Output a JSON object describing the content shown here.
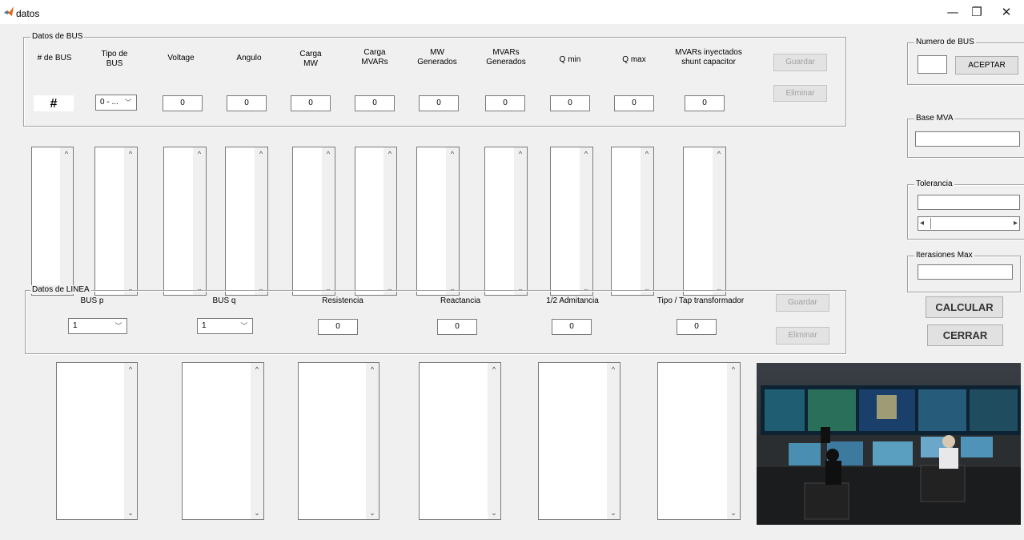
{
  "window": {
    "title": "datos",
    "minimize": "—",
    "restore": "❐",
    "close": "✕"
  },
  "bus_group": {
    "label": "Datos de BUS",
    "headers": [
      "# de BUS",
      "Tipo de\nBUS",
      "Voltage",
      "Angulo",
      "Carga\nMW",
      "Carga\nMVARs",
      "MW\nGenerados",
      "MVARs\nGenerados",
      "Q min",
      "Q  max",
      "MVARs inyectados\nshunt capacitor"
    ],
    "bus_number": "#",
    "tipo_value": "0 - ...",
    "values": [
      "0",
      "0",
      "0",
      "0",
      "0",
      "0",
      "0",
      "0",
      "0"
    ],
    "save_label": "Guardar",
    "delete_label": "Eliminar"
  },
  "line_group": {
    "label": "Datos de LINEA",
    "headers": [
      "BUS p",
      "BUS q",
      "Resistencia",
      "Reactancia",
      "1/2  Admitancia",
      "Tipo  /  Tap transformador"
    ],
    "bus_p_value": "1",
    "bus_q_value": "1",
    "values": [
      "0",
      "0",
      "0",
      "0"
    ],
    "save_label": "Guardar",
    "delete_label": "Eliminar"
  },
  "right_panel": {
    "numero_label": "Numero de BUS",
    "numero_value": "",
    "aceptar_label": "ACEPTAR",
    "base_label": "Base  MVA",
    "base_value": "",
    "tolerancia_label": "Tolerancia",
    "tolerancia_value": "",
    "iter_label": "Iterasiones  Max",
    "iter_value": "",
    "calcular_label": "CALCULAR",
    "cerrar_label": "CERRAR"
  },
  "icons": {
    "scroll_up": "^",
    "scroll_down": "⌄",
    "dropdown": "﹀",
    "left": "◂",
    "right": "▸"
  },
  "colors": {
    "window_bg": "#f0f0f0",
    "disabled_text": "#a0a0a0",
    "field_border": "#7a7a7a"
  }
}
